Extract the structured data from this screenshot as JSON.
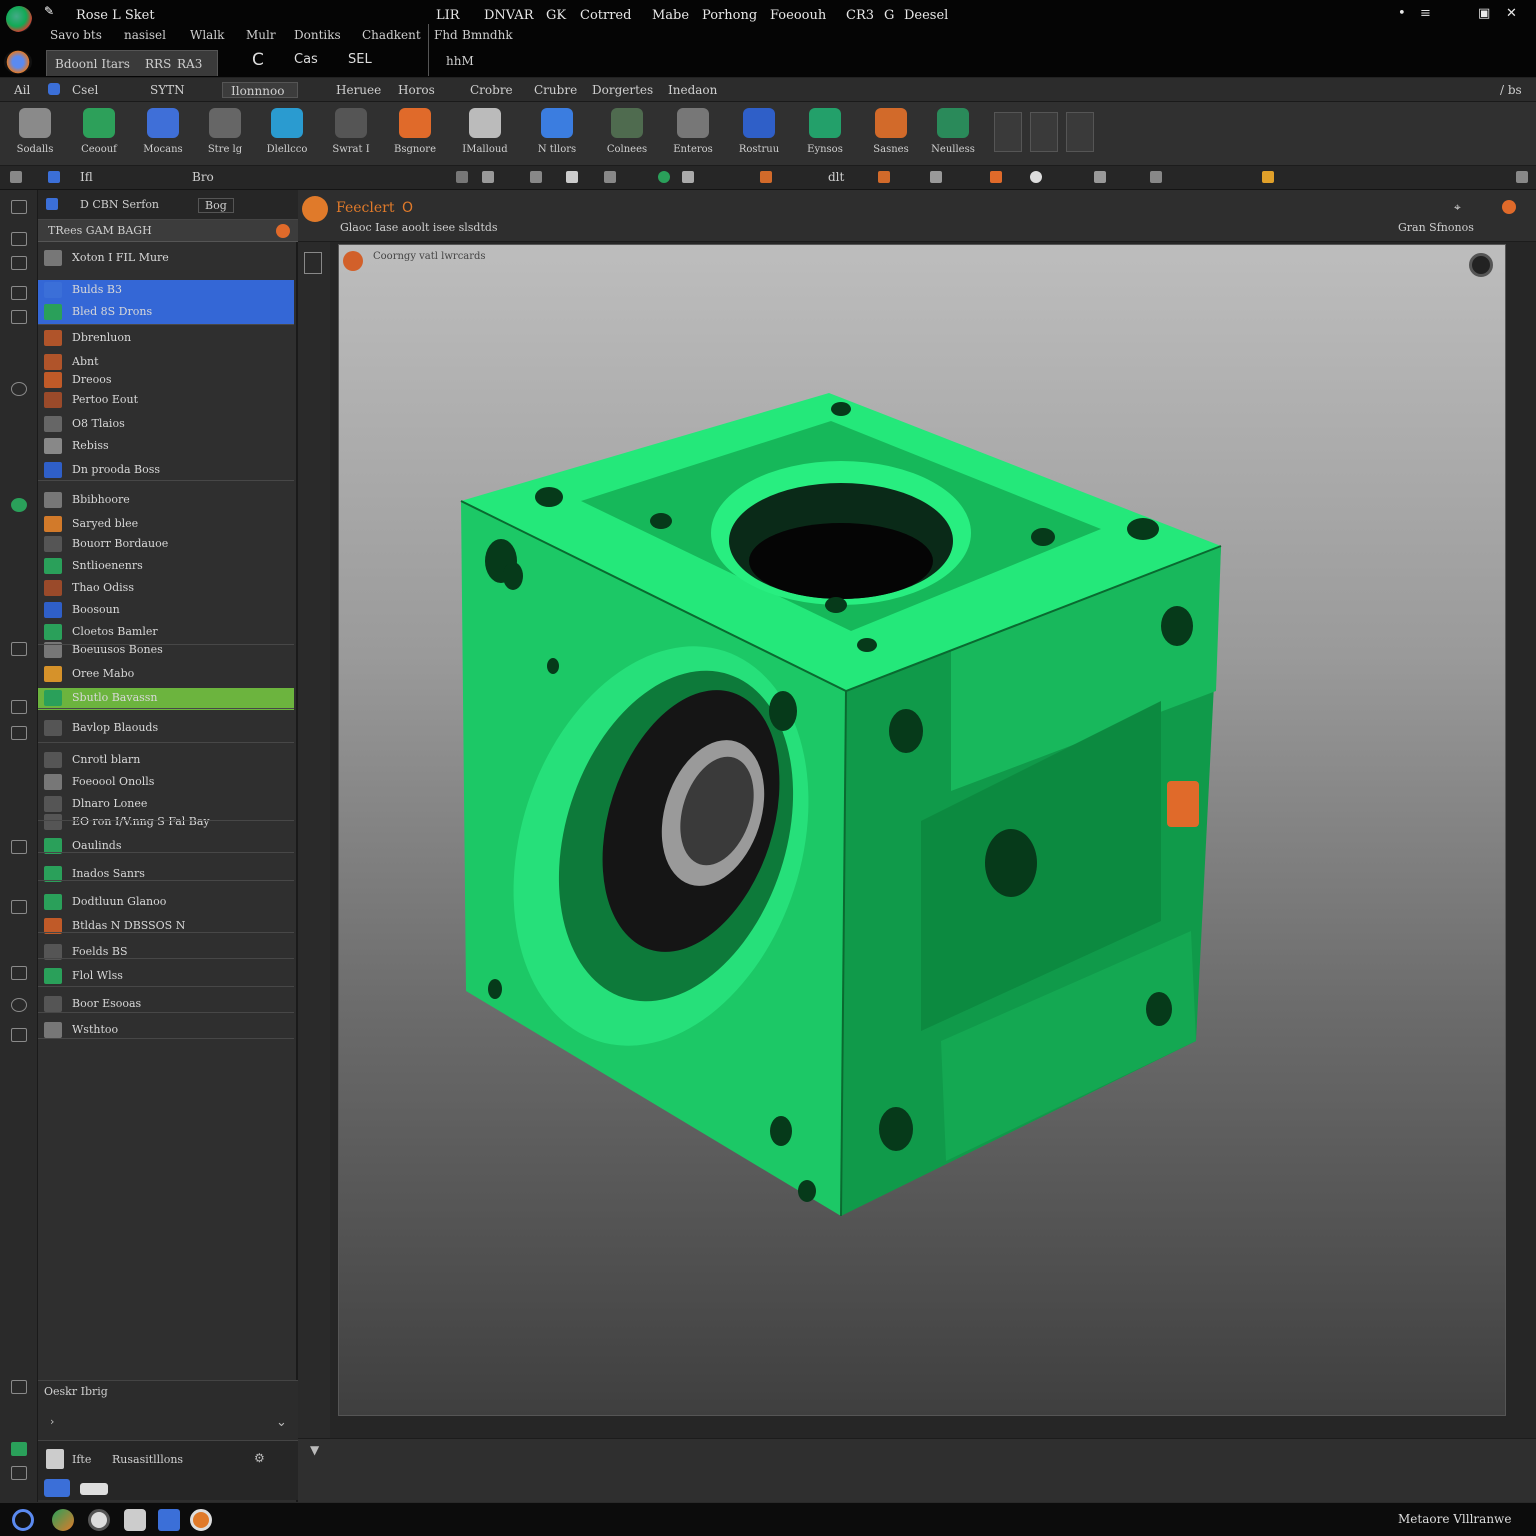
{
  "titlebar": {
    "app_name": "Rose L Sket",
    "sub_labels": [
      "Savo bts",
      "nasisel",
      "Wlalk",
      "Mulr",
      "Dontiks",
      "Chadkent"
    ],
    "right_menu": [
      "LIR",
      "DNVAR",
      "GK",
      "Cotrred",
      "Mabe",
      "Porhong",
      "Foeoouh",
      "CR3",
      "G",
      "Deesel"
    ],
    "sub_right": [
      "Fhd",
      "Bmndhk"
    ],
    "tab_label": "Bdoonl Itars",
    "tab_label2": "RRS",
    "tab_label3": "RA3",
    "controls": [
      "C",
      "Cas",
      "SEL"
    ],
    "nav_label": "hhM",
    "window_controls": [
      "•",
      "≡",
      "▣",
      "✕"
    ]
  },
  "menubar": {
    "items": [
      "Ail",
      "Csel",
      "SYTN",
      "Ilonnnoo",
      "Heruee",
      "Horos",
      "Crobre",
      "Crubre",
      "Dorgertes",
      "Inedaon"
    ],
    "right_label": "/ bs"
  },
  "ribbon": {
    "buttons": [
      {
        "label": "Sodalls",
        "icon": "cube-icon",
        "color": "#8a8a8a"
      },
      {
        "label": "Ceoouf",
        "icon": "cylinder-icon",
        "color": "#2da05a"
      },
      {
        "label": "Mocans",
        "icon": "flag-icon",
        "color": "#3f6fd8"
      },
      {
        "label": "Stre lg",
        "icon": "sphere-icon",
        "color": "#666666"
      },
      {
        "label": "Dlellcco",
        "icon": "wrench-icon",
        "color": "#2a9bd0"
      },
      {
        "label": "Swrat I",
        "icon": "ball-icon",
        "color": "#555555"
      },
      {
        "label": "Bsgnore",
        "icon": "tag-icon",
        "color": "#e06a2a"
      },
      {
        "label": "IMalloud",
        "icon": "eye-icon",
        "color": "#bbbbbb"
      },
      {
        "label": "N tllors",
        "icon": "cube-blue-icon",
        "color": "#3b7de0"
      },
      {
        "label": "Colnees",
        "icon": "gear-icon",
        "color": "#4f6b4f"
      },
      {
        "label": "Enteros",
        "icon": "ruler-icon",
        "color": "#777777"
      },
      {
        "label": "Rostruu",
        "icon": "sheet-icon",
        "color": "#2f5fc8"
      },
      {
        "label": "Eynsos",
        "icon": "stack-icon",
        "color": "#23a06a"
      },
      {
        "label": "Sasnes",
        "icon": "hex-icon",
        "color": "#d26a2a"
      },
      {
        "label": "Neulless",
        "icon": "panel-icon",
        "color": "#2a8a5a"
      }
    ],
    "extra": [
      "pen-icon",
      "pencil-icon",
      "list-icon"
    ]
  },
  "toolbar2": {
    "label_left": "Ifl",
    "label_mid": "Bro",
    "label_right": "dlt"
  },
  "tree": {
    "header": "D CBN Serfon",
    "header_btn": "Bog",
    "subheader": "TRees GAM BAGH",
    "rows": [
      {
        "label": "Xoton I FIL Mure",
        "icon_color": "#777777"
      },
      {
        "label": "Bulds B3",
        "icon_color": "#3b6fd8",
        "selected": "blue"
      },
      {
        "label": "Bled 8S Drons",
        "icon_color": "#2aa05a",
        "selected": "blue"
      },
      {
        "label": "Dbrenluon",
        "icon_color": "#b0542a"
      },
      {
        "label": "Abnt",
        "icon_color": "#b0542a"
      },
      {
        "label": "Dreoos",
        "icon_color": "#c05a28"
      },
      {
        "label": "Pertoo Eout",
        "icon_color": "#9a4a2a"
      },
      {
        "label": "O8 Tlaios",
        "icon_color": "#666666"
      },
      {
        "label": "Rebiss",
        "icon_color": "#888888"
      },
      {
        "label": "Dn prooda Boss",
        "icon_color": "#2f5fc8"
      },
      {
        "label": "Bbibhoore",
        "icon_color": "#777777"
      },
      {
        "label": "Saryed blee",
        "icon_color": "#d27a2a"
      },
      {
        "label": "Bouorr Bordauoe",
        "icon_color": "#555555"
      },
      {
        "label": "Sntlioenenrs",
        "icon_color": "#2aa05a"
      },
      {
        "label": "Thao Odiss",
        "icon_color": "#9a4a2a"
      },
      {
        "label": "Boosoun",
        "icon_color": "#2f5fc8"
      },
      {
        "label": "Cloetos Bamler",
        "icon_color": "#2aa05a"
      },
      {
        "label": "Boeuusos Bones",
        "icon_color": "#777777"
      },
      {
        "label": "Oree Mabo",
        "icon_color": "#d6922a"
      },
      {
        "label": "Sbutlo Bavassn",
        "icon_color": "#2aa05a",
        "selected": "green"
      },
      {
        "label": "Bavlop Blaouds",
        "icon_color": "#555555"
      },
      {
        "label": "Cnrotl blarn",
        "icon_color": "#555555"
      },
      {
        "label": "Foeoool Onolls",
        "icon_color": "#777777"
      },
      {
        "label": "Dlnaro Lonee",
        "icon_color": "#555555"
      },
      {
        "label": "EO ron I/V.nng S Fal Bay",
        "icon_color": "#555555"
      },
      {
        "label": "Oaulinds",
        "icon_color": "#2aa05a"
      },
      {
        "label": "Inados Sanrs",
        "icon_color": "#2aa05a"
      },
      {
        "label": "Dodtluun Glanoo",
        "icon_color": "#2aa05a"
      },
      {
        "label": "Btldas N DBSSOS N",
        "icon_color": "#c05a28"
      },
      {
        "label": "Foelds BS",
        "icon_color": "#555555"
      },
      {
        "label": "Flol Wlss",
        "icon_color": "#2aa05a"
      },
      {
        "label": "Boor Esooas",
        "icon_color": "#555555"
      },
      {
        "label": "Wsthtoo",
        "icon_color": "#777777"
      }
    ],
    "footer_label": "Oeskr Ibrig",
    "bottom_label": "Ifte",
    "bottom_label2": "Rusasitlllons"
  },
  "document": {
    "tab_title": "Feeclert",
    "tab_indicator": "O",
    "breadcrumb": "Glaoc Iase aoolt isee slsdtds",
    "right_label": "Gran Sfnonos",
    "viewport_label": "Coorngy vatl lwrcards",
    "part_color": "#1ee070",
    "part_shadow": "#0a8a3c",
    "accent": "#e06a2a"
  },
  "taskbar": {
    "icons": [
      "start-icon",
      "app-icon",
      "browser-icon",
      "files-icon",
      "blue-app-icon",
      "orange-app-icon"
    ],
    "right_label": "Metaore Vlllranwe"
  }
}
